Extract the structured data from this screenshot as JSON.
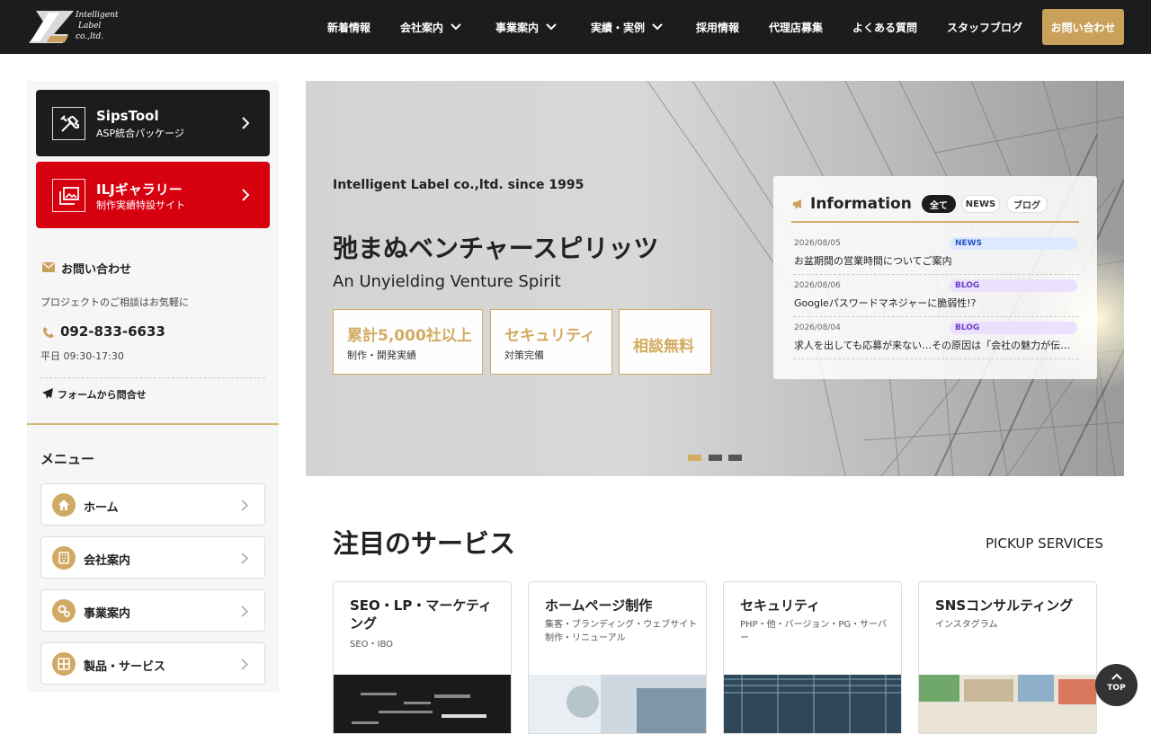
{
  "header": {
    "logo_text": [
      "Intelligent",
      "Label",
      "co.,ltd."
    ],
    "nav": [
      {
        "label": "新着情報",
        "dropdown": false
      },
      {
        "label": "会社案内",
        "dropdown": true
      },
      {
        "label": "事業案内",
        "dropdown": true
      },
      {
        "label": "実績・実例",
        "dropdown": true
      },
      {
        "label": "採用情報",
        "dropdown": false
      },
      {
        "label": "代理店募集",
        "dropdown": false
      },
      {
        "label": "よくある質問",
        "dropdown": false
      },
      {
        "label": "スタッフブログ",
        "dropdown": false
      }
    ],
    "cta_label": "お問い合わせ"
  },
  "sidebar": {
    "promos": [
      {
        "title": "SipsTool",
        "subtitle": "ASP統合パッケージ",
        "icon": "tools-icon",
        "color": "#1c1c1c"
      },
      {
        "title": "ILJギャラリー",
        "subtitle": "制作実績特設サイト",
        "icon": "gallery-icon",
        "color": "#d7000f"
      }
    ],
    "contact": {
      "heading": "お問い合わせ",
      "lead": "プロジェクトのご相談はお気軽に",
      "phone": "092-833-6633",
      "hours": "平日 09:30-17:30",
      "form_link": "フォームから問合せ"
    },
    "menu_heading": "メニュー",
    "menu": [
      {
        "label": "ホーム",
        "icon": "home-icon"
      },
      {
        "label": "会社案内",
        "icon": "building-icon"
      },
      {
        "label": "事業案内",
        "icon": "gears-icon"
      },
      {
        "label": "製品・サービス",
        "icon": "grid-icon"
      }
    ]
  },
  "hero": {
    "since": "Intelligent Label co.,ltd. since 1995",
    "title": "弛まぬベンチャースピリッツ",
    "subtitle": "An Unyielding Venture Spirit",
    "features": [
      {
        "main": "累計5,000社以上",
        "sub": "制作・開発実績"
      },
      {
        "main": "セキュリティ",
        "sub": "対策完備"
      },
      {
        "main": "相談無料",
        "sub": ""
      }
    ],
    "slides": 3,
    "active_slide": 1
  },
  "info": {
    "title": "Information",
    "filters": [
      "全て",
      "NEWS",
      "ブログ"
    ],
    "active_filter": "全て",
    "items": [
      {
        "date": "2026/08/05",
        "tag": "NEWS",
        "title": "お盆期間の営業時間についてご案内"
      },
      {
        "date": "2026/08/06",
        "tag": "BLOG",
        "title": "Googleパスワードマネジャーに脆弱性!?"
      },
      {
        "date": "2026/08/04",
        "tag": "BLOG",
        "title": "求人を出しても応募が来ない…その原因は「会社の魅力が伝…"
      }
    ]
  },
  "services": {
    "title": "注目のサービス",
    "title_en": "PICKUP SERVICES",
    "cards": [
      {
        "title": "SEO・LP・マーケティング",
        "sub": "SEO・IBO"
      },
      {
        "title": "ホームページ制作",
        "sub": "集客・ブランディング・ウェブサイト制作・リニューアル"
      },
      {
        "title": "セキュリティ",
        "sub": "PHP・他・バージョン・PG・サーバー"
      },
      {
        "title": "SNSコンサルティング",
        "sub": "インスタグラム"
      }
    ]
  },
  "top_button": "TOP",
  "colors": {
    "gold": "#c9a15a",
    "dark": "#1c1c1c",
    "red": "#d7000f",
    "news_tag": "#dce9ff",
    "blog_tag": "#ece0ff"
  }
}
